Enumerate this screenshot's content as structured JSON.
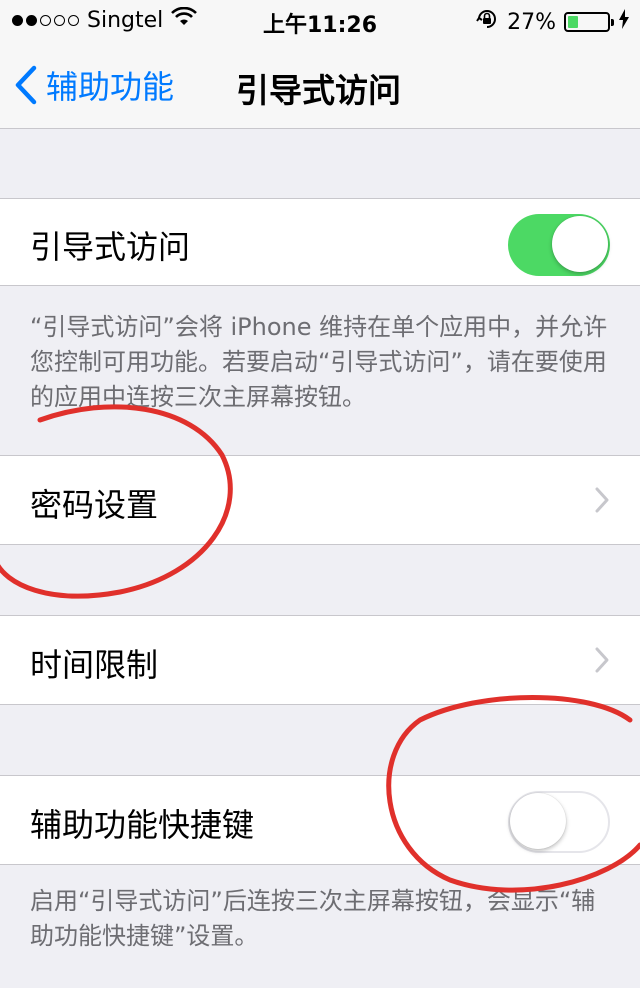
{
  "status_bar": {
    "carrier": "Singtel",
    "signal_bars_filled": 2,
    "signal_bars_total": 5,
    "time": "上午11:26",
    "battery_percent": "27%",
    "battery_level": 0.27,
    "icons": [
      "wifi-icon",
      "orientation-lock-icon",
      "battery-icon",
      "charging-bolt-icon"
    ]
  },
  "nav": {
    "back_label": "辅助功能",
    "title": "引导式访问"
  },
  "settings": {
    "guided_access": {
      "label": "引导式访问",
      "enabled": true
    },
    "guided_access_note": "“引导式访问”会将 iPhone 维持在单个应用中，并允许您控制可用功能。若要启动“引导式访问”，请在要使用的应用中连按三次主屏幕按钮。",
    "passcode_settings": {
      "label": "密码设置"
    },
    "time_limits": {
      "label": "时间限制"
    },
    "accessibility_shortcut": {
      "label": "辅助功能快捷键",
      "enabled": false
    },
    "shortcut_note": "启用“引导式访问”后连按三次主屏幕按钮，会显示“辅助功能快捷键”设置。"
  },
  "colors": {
    "accent": "#007aff",
    "toggle_on": "#4cd964",
    "annotation": "#e0302b",
    "background": "#efeff4"
  }
}
